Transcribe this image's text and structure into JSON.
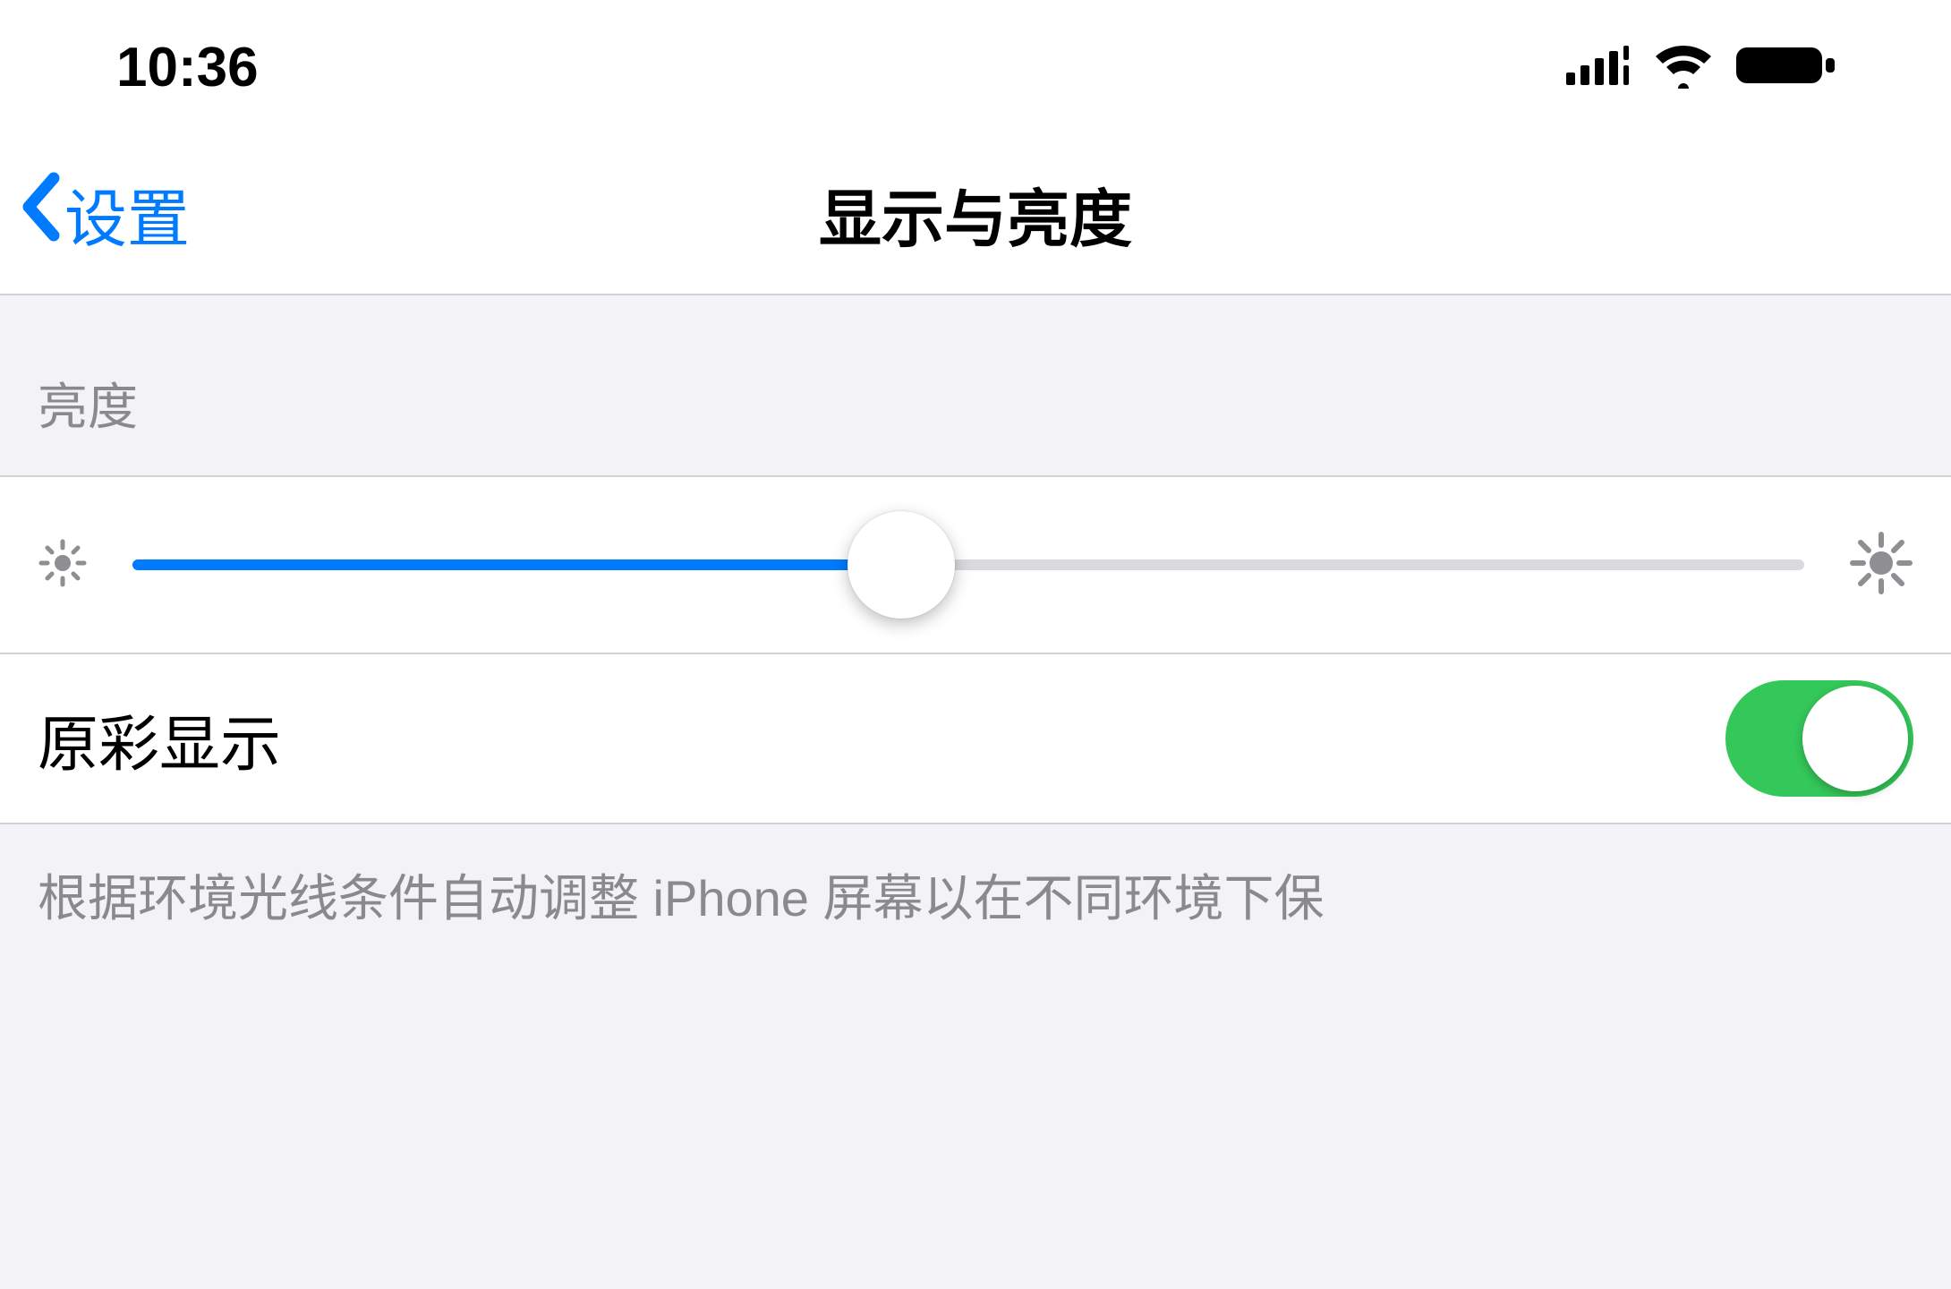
{
  "status_bar": {
    "time": "10:36"
  },
  "nav": {
    "back_label": "设置",
    "title": "显示与亮度"
  },
  "brightness_section": {
    "header": "亮度",
    "slider_percent": 46
  },
  "true_tone": {
    "label": "原彩显示",
    "enabled": true
  },
  "footer": {
    "text": "根据环境光线条件自动调整 iPhone 屏幕以在不同环境下保"
  },
  "colors": {
    "accent": "#007aff",
    "toggle_on": "#34c759"
  }
}
